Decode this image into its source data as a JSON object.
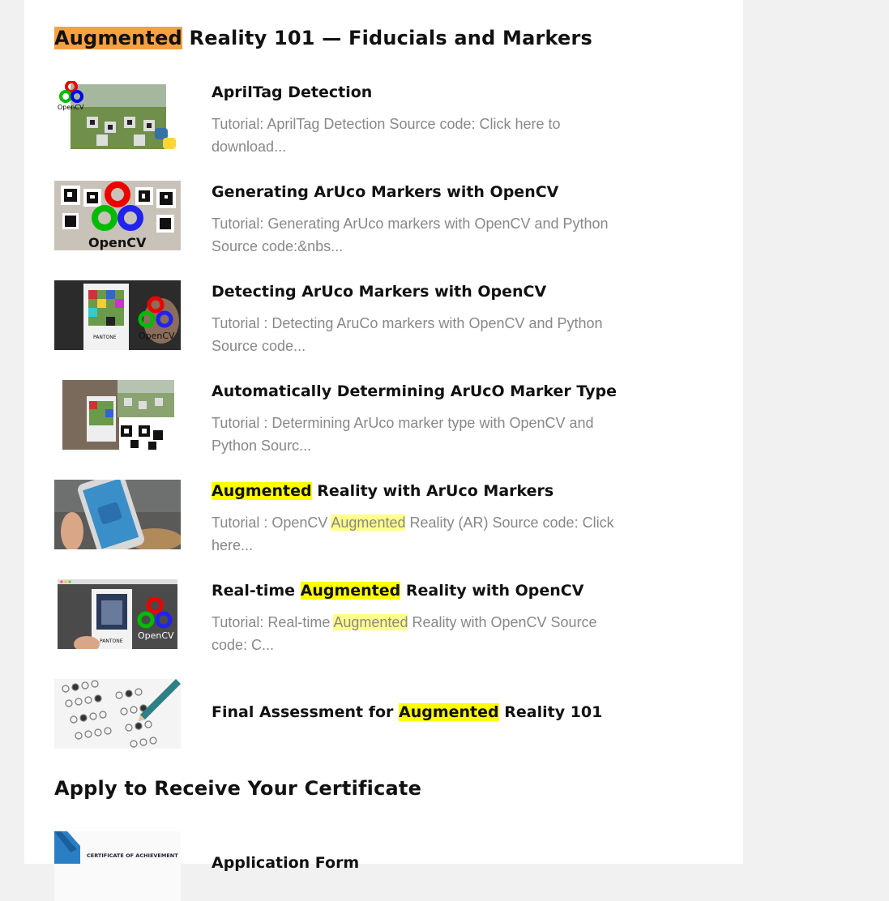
{
  "section1": {
    "title_highlight": "Augmented",
    "title_rest": " Reality 101 — Fiducials and Markers"
  },
  "lessons": [
    {
      "title": "AprilTag Detection",
      "desc": "Tutorial: AprilTag Detection Source code: Click here to download..."
    },
    {
      "title": "Generating ArUco Markers with OpenCV",
      "desc": "Tutorial: Generating ArUco markers with OpenCV and Python Source code:&nbs..."
    },
    {
      "title": "Detecting ArUco Markers with OpenCV",
      "desc": "Tutorial : Detecting AruCo markers with OpenCV and Python Source code..."
    },
    {
      "title": "Automatically Determining ArUcO Marker Type",
      "desc": "Tutorial : Determining ArUco marker type with OpenCV and Python Sourc..."
    },
    {
      "title_highlight": "Augmented",
      "title_rest": " Reality with ArUco Markers",
      "desc_pre": "Tutorial : OpenCV ",
      "desc_highlight": "Augmented",
      "desc_post": " Reality (AR) Source code: Click here..."
    },
    {
      "title_pre": "Real-time ",
      "title_highlight": "Augmented",
      "title_post": " Reality with OpenCV",
      "desc_pre": "Tutorial: Real-time ",
      "desc_highlight": "Augmented",
      "desc_post": " Reality with OpenCV Source code: C..."
    },
    {
      "title_pre": "Final Assessment for ",
      "title_highlight": "Augmented",
      "title_post": " Reality 101"
    }
  ],
  "section2": {
    "title": "Apply to Receive Your Certificate"
  },
  "certificate": {
    "title": "Application Form",
    "thumb_text": "CERTIFICATE OF ACHIEVEMENT"
  },
  "colors": {
    "page_bg": "#f1f1f1",
    "panel_bg": "#ffffff",
    "highlight_orange": "#f7a03f",
    "highlight_yellow": "#ffff00",
    "highlight_pale": "#ffff8a",
    "desc_gray": "#888888"
  }
}
